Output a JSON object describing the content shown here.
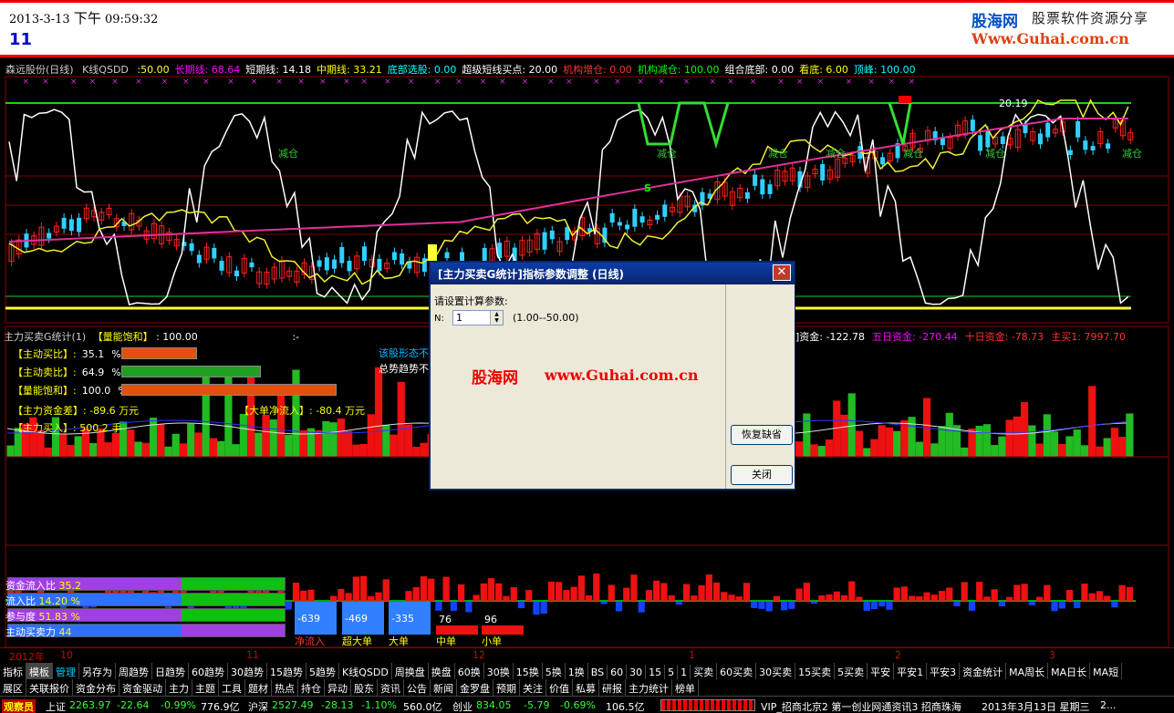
{
  "header": {
    "date": "2013-3-13",
    "ampm": "下午",
    "time": "09:59:32",
    "period_code": "11",
    "logo_cn": "股海网",
    "logo_tagline": "股票软件资源分享",
    "logo_url": "Www.Guhai.com.cn"
  },
  "kline_header": {
    "stock": "森远股份(日线)",
    "indicator": "K线QSDD",
    "values": [
      {
        "label": ":50.00",
        "color": "#ff3"
      },
      {
        "label": "长期线: 68.64",
        "color": "#f0f"
      },
      {
        "label": "短期线: 14.18",
        "color": "#fff"
      },
      {
        "label": "中期线: 33.21",
        "color": "#ff0"
      },
      {
        "label": "底部选股: 0.00",
        "color": "#0ff"
      },
      {
        "label": "超级短线买点: 20.00",
        "color": "#fff"
      },
      {
        "label": "机构增仓: 0.00",
        "color": "#f33"
      },
      {
        "label": "机构减仓: 100.00",
        "color": "#0f0"
      },
      {
        "label": "组合底部: 0.00",
        "color": "#fff"
      },
      {
        "label": "看底: 6.00",
        "color": "#ff0"
      },
      {
        "label": "顶峰: 100.00",
        "color": "#0ff"
      }
    ],
    "price_label": "20.19",
    "markers": [
      "减仓",
      "减仓",
      "减仓",
      "减仓",
      "减仓",
      "减仓",
      "减仓"
    ],
    "s_marker": "S"
  },
  "indicator": {
    "title": "主力买卖G统计(1)",
    "saturation_label": "【量能饱和】",
    "saturation_value": ": 100.00",
    "dash": ":-",
    "right_items": [
      {
        "label": "]资金: -122.78",
        "color": "#fff"
      },
      {
        "label": "五日资金: -270.44",
        "color": "#f0f"
      },
      {
        "label": "十日资金: -78.73",
        "color": "#f33"
      },
      {
        "label": "主买1: 7997.70",
        "color": "#f33"
      }
    ],
    "stats": [
      {
        "label": "【主动买比】:",
        "value": "35.1",
        "unit": "%",
        "fill": 0.351,
        "color": "#e05010"
      },
      {
        "label": "【主动卖比】:",
        "value": "64.9",
        "unit": "%",
        "fill": 0.649,
        "color": "#20a020"
      },
      {
        "label": "【量能饱和】:",
        "value": "100.0",
        "unit": "%",
        "fill": 1.0,
        "color": "#e05010"
      }
    ],
    "fund_diff": "【主力资金差】: -89.6 万元",
    "big_inflow": "【大单净流入】: -80.4 万元",
    "main_buy": "【主力买入】: 500.2 手",
    "pattern_line1": "该股形态不",
    "pattern_line2": "总势趋势不"
  },
  "flow": {
    "rows": [
      {
        "label": "资金流入比",
        "value": "35.2"
      },
      {
        "label": "流入比",
        "value": "14.20 %"
      },
      {
        "label": "参与度",
        "value": "51.83 %"
      },
      {
        "label": "主动买卖力",
        "value": "44"
      }
    ],
    "boxes": [
      {
        "value": "-639",
        "caption": "净流入"
      },
      {
        "value": "-469",
        "caption": "超大单"
      },
      {
        "value": "-335",
        "caption": "大单"
      },
      {
        "value": "76",
        "caption": "中单"
      },
      {
        "value": "96",
        "caption": "小单"
      }
    ]
  },
  "dialog": {
    "title": "[主力买卖G统计]指标参数调整 (日线)",
    "prompt": "请设置计算参数:",
    "param_name": "N:",
    "param_value": "1",
    "param_range": "(1.00--50.00)",
    "watermark_cn": "股海网",
    "watermark_url": "www.Guhai.com.cn",
    "restore_button": "恢复缺省",
    "close_button": "关闭"
  },
  "date_bar": [
    "2012年",
    "10",
    "11",
    "12",
    "1",
    "2",
    "3"
  ],
  "toolbar1": [
    "指标",
    "模板",
    "管理",
    "另存为",
    "周趋势",
    "日趋势",
    "60趋势",
    "30趋势",
    "15趋势",
    "5趋势",
    "K线QSDD",
    "周换盘",
    "换盘",
    "60换",
    "30换",
    "15换",
    "5换",
    "1换",
    "BS",
    "60",
    "30",
    "15",
    "5",
    "1",
    "买卖",
    "60买卖",
    "30买卖",
    "15买卖",
    "5买卖",
    "平安",
    "平安1",
    "平安3",
    "资金统计",
    "MA周长",
    "MA日长",
    "MA短"
  ],
  "toolbar2": [
    "展区",
    "关联报价",
    "资金分布",
    "资金驱动",
    "主力",
    "主题",
    "工具",
    "题材",
    "热点",
    "持仓",
    "异动",
    "股东",
    "资讯",
    "公告",
    "新闻",
    "金罗盘",
    "预期",
    "关注",
    "价值",
    "私募",
    "研报",
    "主力统计",
    "榜单"
  ],
  "status": {
    "brand": "观察员",
    "sh_label": "上证",
    "sh_index": "2263.97",
    "sh_change": "-22.64",
    "sh_pct": "-0.99%",
    "sh_amount": "776.9亿",
    "sz_label": "沪深",
    "sz_index": "2527.49",
    "sz_change": "-28.13",
    "sz_pct": "-1.10%",
    "sz_amount": "560.0亿",
    "cy_label": "创业",
    "cy_index": "834.05",
    "cy_change": "-5.79",
    "cy_pct": "-0.69%",
    "cy_amount": "106.5亿",
    "news": "VIP_招商北京2  第一创业网通资讯3  招商珠海",
    "date": "2013年3月13日 星期三",
    "tail": "2..."
  },
  "colors": {
    "up": "#ff2020",
    "down": "#30d0ff",
    "grid": "#800000"
  }
}
